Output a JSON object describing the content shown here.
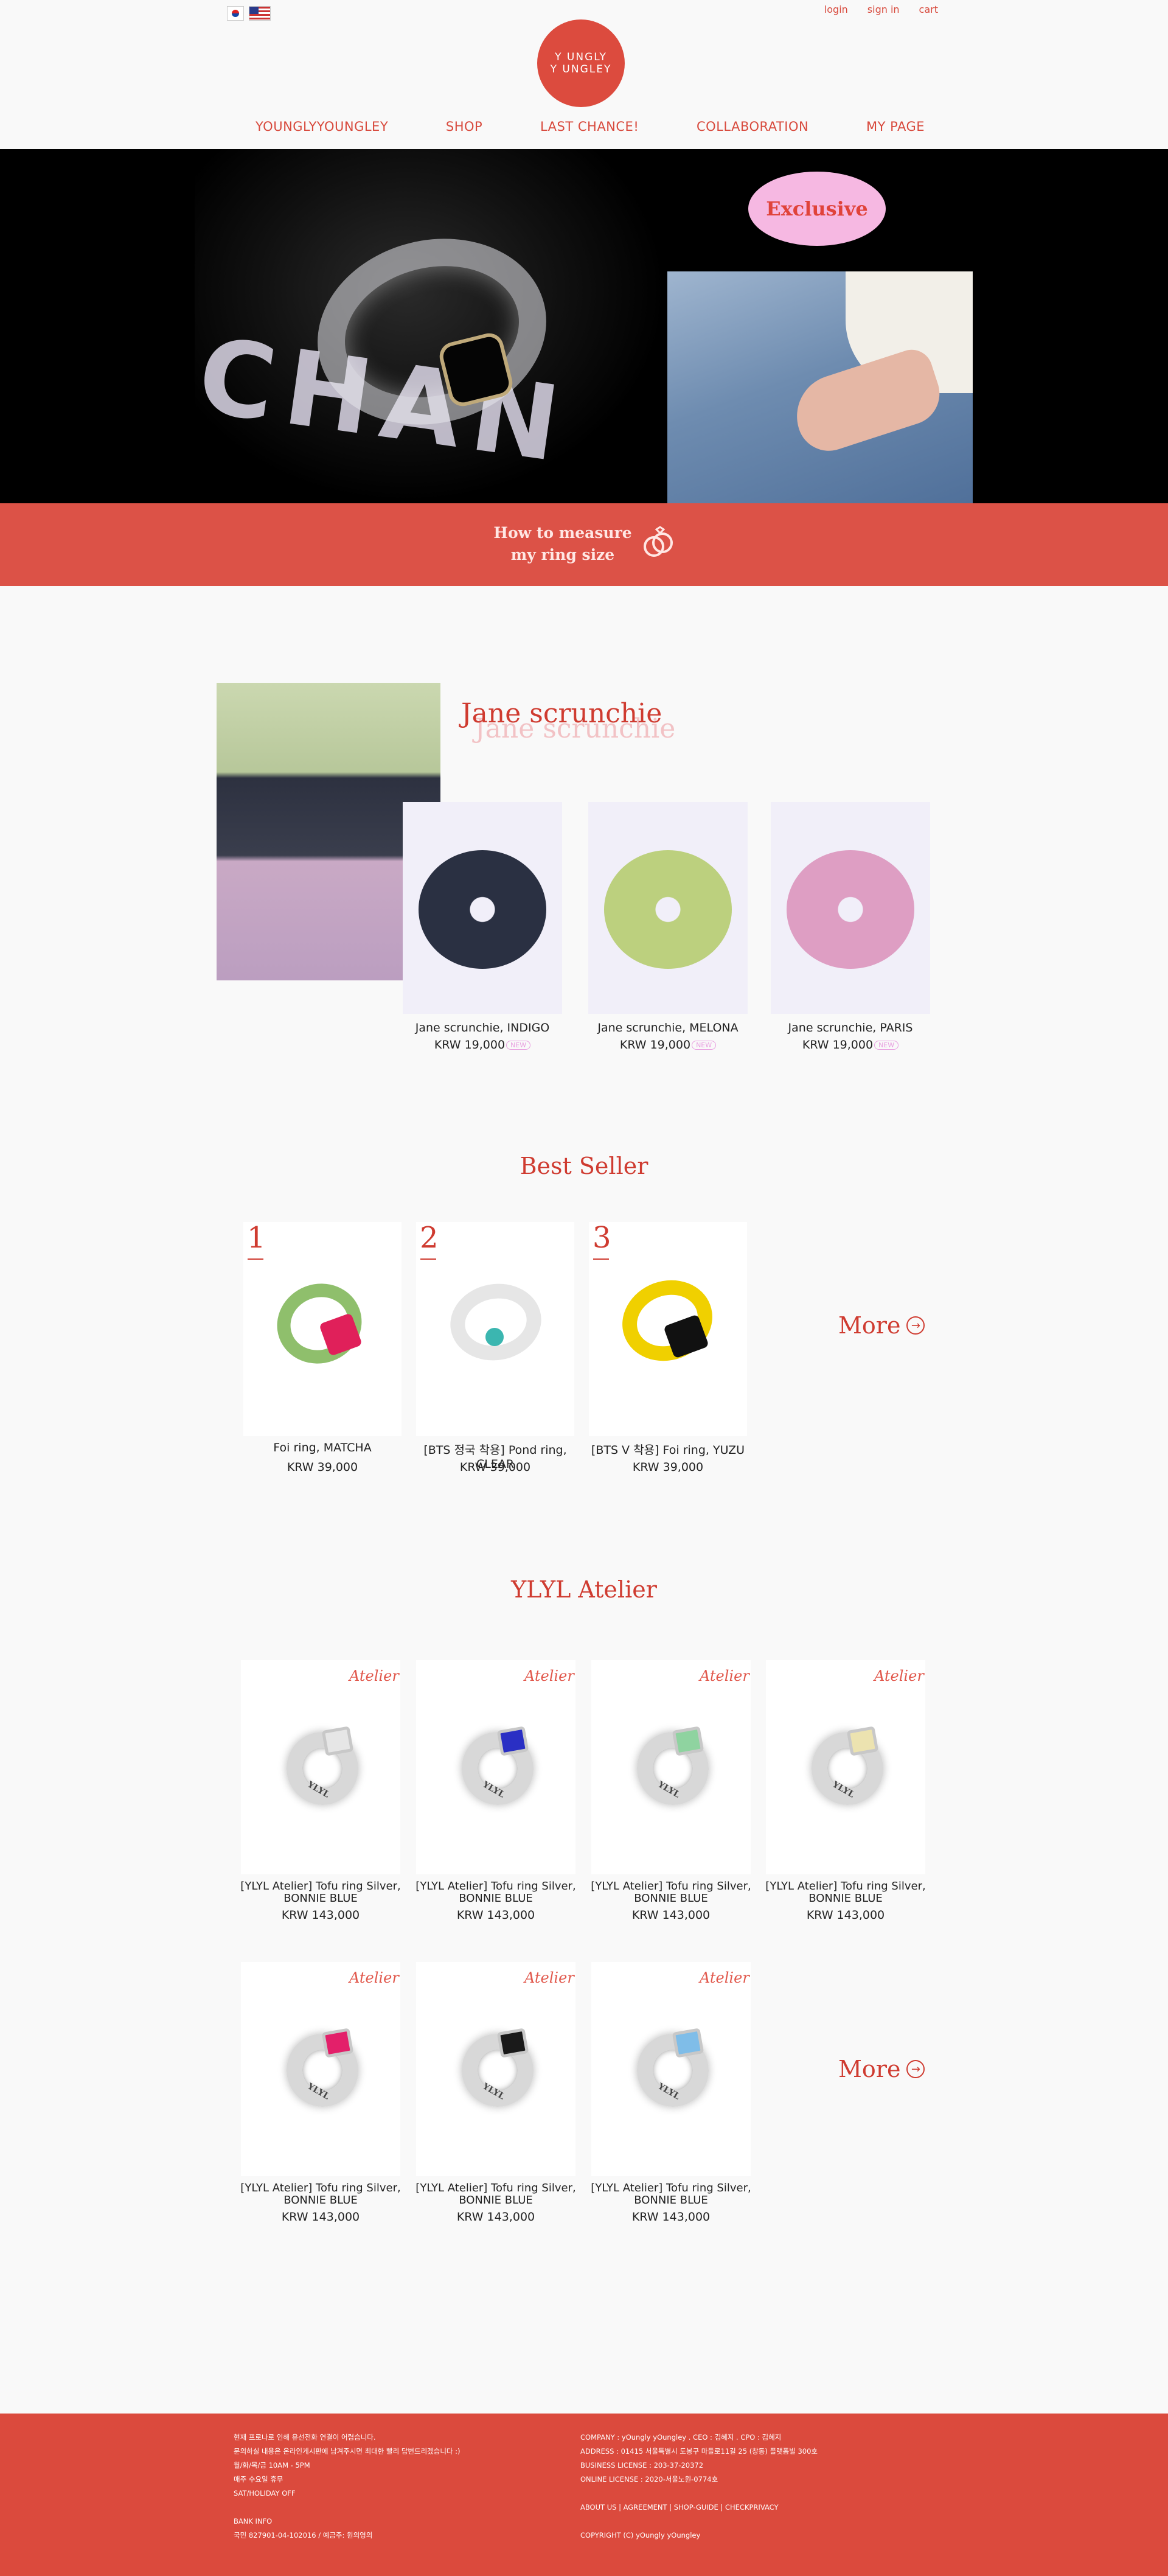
{
  "header": {
    "top_links": [
      "login",
      "sign in",
      "cart"
    ],
    "logo_line1": "Y UNGLY",
    "logo_line2": "Y UNGLEY",
    "nav": [
      "YOUNGLYYOUNGLEY",
      "SHOP",
      "LAST CHANCE!",
      "COLLABORATION",
      "MY PAGE"
    ]
  },
  "hero": {
    "background_text": "CHAN",
    "exclusive": "Exclusive",
    "measure_line1": "How to measure",
    "measure_line2": "my ring size"
  },
  "jane": {
    "title": "Jane scrunchie",
    "products": [
      {
        "name": "Jane scrunchie, INDIGO",
        "price": "KRW 19,000",
        "badge": "NEW",
        "color": "#2a3042"
      },
      {
        "name": "Jane scrunchie, MELONA",
        "price": "KRW 19,000",
        "badge": "NEW",
        "color": "#bcd07e"
      },
      {
        "name": "Jane scrunchie, PARIS",
        "price": "KRW 19,000",
        "badge": "NEW",
        "color": "#de9ec3"
      }
    ]
  },
  "best_seller": {
    "title": "Best Seller",
    "more": "More",
    "products": [
      {
        "rank": "1",
        "name": "Foi ring, MATCHA",
        "price": "KRW 39,000",
        "band": "#8fbf6c",
        "stone": "#e0205a"
      },
      {
        "rank": "2",
        "name": "[BTS 정국 착용] Pond ring, CLEAR",
        "price": "KRW 39,000",
        "band": "#e6e6e6",
        "stone": "#3bb6b0"
      },
      {
        "rank": "3",
        "name": "[BTS V 착용] Foi ring, YUZU",
        "price": "KRW 39,000",
        "band": "#f0d000",
        "stone": "#111111"
      }
    ]
  },
  "atelier": {
    "title": "YLYL Atelier",
    "tag": "Atelier",
    "engrave": "YLYL",
    "more": "More",
    "products": [
      {
        "name_line1": "[YLYL Atelier] Tofu ring Silver,",
        "name_line2": "BONNIE BLUE",
        "price": "KRW 143,000",
        "stone": "#e6e6e6"
      },
      {
        "name_line1": "[YLYL Atelier] Tofu ring Silver,",
        "name_line2": "BONNIE BLUE",
        "price": "KRW 143,000",
        "stone": "#2a2fc4"
      },
      {
        "name_line1": "[YLYL Atelier] Tofu ring Silver,",
        "name_line2": "BONNIE BLUE",
        "price": "KRW 143,000",
        "stone": "#8fd3a0"
      },
      {
        "name_line1": "[YLYL Atelier] Tofu ring Silver,",
        "name_line2": "BONNIE BLUE",
        "price": "KRW 143,000",
        "stone": "#ece3b0"
      },
      {
        "name_line1": "[YLYL Atelier] Tofu ring Silver,",
        "name_line2": "BONNIE BLUE",
        "price": "KRW 143,000",
        "stone": "#e3206a"
      },
      {
        "name_line1": "[YLYL Atelier] Tofu ring Silver,",
        "name_line2": "BONNIE BLUE",
        "price": "KRW 143,000",
        "stone": "#1a1a1a"
      },
      {
        "name_line1": "[YLYL Atelier] Tofu ring Silver,",
        "name_line2": "BONNIE BLUE",
        "price": "KRW 143,000",
        "stone": "#7fbde8"
      }
    ]
  },
  "footer": {
    "left": [
      "현재 프로나로 인해 유선전화 연결이 어렵습니다.",
      "문의하실 내용은 온라인게시판에 남겨주시면 최대한 빨리 답변드리겠습니다 :)",
      "월/화/목/금 10AM - 5PM",
      "매주 수요일 휴무",
      "SAT/HOLIDAY OFF",
      "",
      "BANK INFO",
      "국민 827901-04-102016 / 예금주: 원의영의"
    ],
    "right": [
      "COMPANY : yOungly yOungley . CEO : 김혜지 . CPO : 김혜지",
      "ADDRESS : 01415 서울특별시 도봉구 마들로11길 25 (창동) 플랫폼빌 300호",
      "BUSINESS LICENSE : 203-37-20372",
      "ONLINE LICENSE : 2020-서울노원-0774호",
      "",
      "ABOUT US | AGREEMENT | SHOP-GUIDE | CHECKPRIVACY",
      "",
      "COPYRIGHT (C) yOungly yOungley"
    ]
  },
  "colors": {
    "brand": "#dc4b3e",
    "accent_text": "#cf3b30",
    "badge": "#e89ee0"
  }
}
